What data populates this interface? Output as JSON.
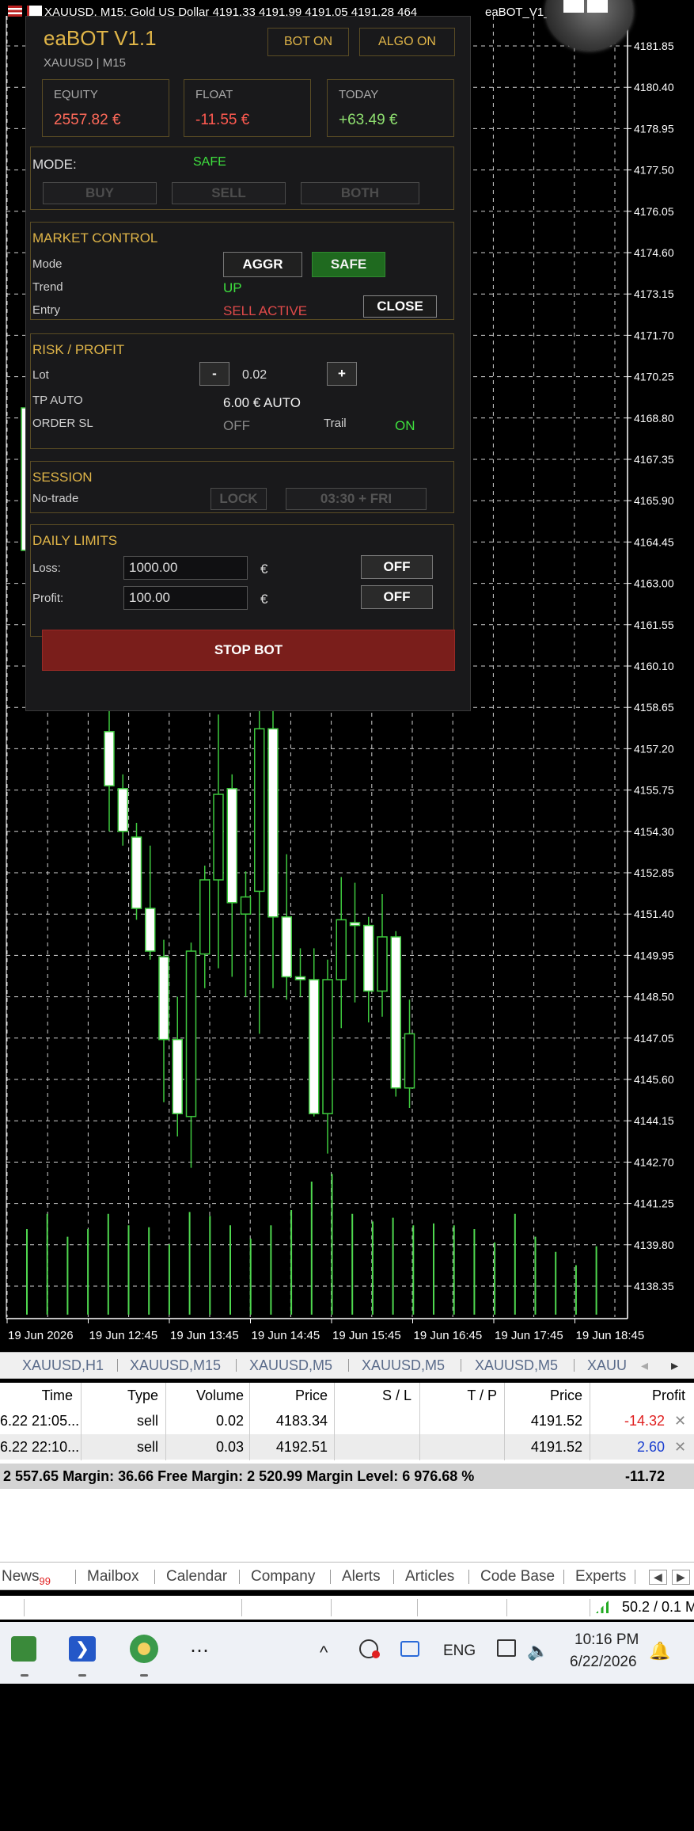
{
  "window": {
    "title": "XAUUSD, M15:  Gold US Dollar  4191.33 4191.99 4191.05 4191.28  464",
    "title_right": "eaBOT_V1_"
  },
  "panel": {
    "title": "eaBOT V1.1",
    "subtitle": "XAUUSD | M15",
    "bot_status": "BOT ON",
    "algo_status": "ALGO ON",
    "stats": [
      {
        "label": "EQUITY",
        "value": "2557.82 €",
        "color": "#ff6a5a"
      },
      {
        "label": "FLOAT",
        "value": "-11.55 €",
        "color": "#ff5a50"
      },
      {
        "label": "TODAY",
        "value": "+63.49 €",
        "color": "#8fe070"
      }
    ],
    "mode": {
      "label": "MODE:",
      "value": "SAFE",
      "buttons": [
        "BUY",
        "SELL",
        "BOTH"
      ]
    },
    "market": {
      "title": "MARKET CONTROL",
      "mode_label": "Mode",
      "aggr_label": "AGGR",
      "safe_label": "SAFE",
      "trend_label": "Trend",
      "trend_value": "UP",
      "entry_label": "Entry",
      "entry_value": "SELL ACTIVE",
      "close_label": "CLOSE"
    },
    "risk": {
      "title": "RISK / PROFIT",
      "lot_label": "Lot",
      "minus": "-",
      "lot_value": "0.02",
      "plus": "+",
      "tp_label": "TP AUTO",
      "tp_value": "6.00 € AUTO",
      "sl_label": "ORDER SL",
      "sl_value": "OFF",
      "trail_label": "Trail",
      "trail_value": "ON"
    },
    "session": {
      "title": "SESSION",
      "label": "No-trade",
      "lock_label": "LOCK",
      "time_label": "03:30 + FRI"
    },
    "daily": {
      "title": "DAILY LIMITS",
      "loss_label": "Loss:",
      "loss_value": "1000.00",
      "profit_label": "Profit:",
      "profit_value": "100.00",
      "currency": "€",
      "loss_toggle": "OFF",
      "profit_toggle": "OFF"
    },
    "stop_label": "STOP BOT"
  },
  "chart_data": {
    "type": "candlestick",
    "price_ticks": [
      "4181.85",
      "4180.40",
      "4178.95",
      "4177.50",
      "4176.05",
      "4174.60",
      "4173.15",
      "4171.70",
      "4170.25",
      "4168.80",
      "4167.35",
      "4165.90",
      "4164.45",
      "4163.00",
      "4161.55",
      "4160.10",
      "4158.65",
      "4157.20",
      "4155.75",
      "4154.30",
      "4152.85",
      "4151.40",
      "4149.95",
      "4148.50",
      "4147.05",
      "4145.60",
      "4144.15",
      "4142.70",
      "4141.25",
      "4139.80",
      "4138.35"
    ],
    "time_ticks": [
      "19 Jun 2026",
      "19 Jun 12:45",
      "19 Jun 13:45",
      "19 Jun 14:45",
      "19 Jun 15:45",
      "19 Jun 16:45",
      "19 Jun 17:45",
      "19 Jun 18:45"
    ],
    "candles": [
      {
        "o": 4157.8,
        "h": 4158.6,
        "l": 4154.3,
        "c": 4155.9
      },
      {
        "o": 4155.8,
        "h": 4156.3,
        "l": 4153.8,
        "c": 4154.3
      },
      {
        "o": 4154.1,
        "h": 4154.6,
        "l": 4151.2,
        "c": 4151.6
      },
      {
        "o": 4151.6,
        "h": 4153.8,
        "l": 4149.8,
        "c": 4150.1
      },
      {
        "o": 4149.9,
        "h": 4150.5,
        "l": 4144.8,
        "c": 4147.0
      },
      {
        "o": 4147.0,
        "h": 4148.5,
        "l": 4143.6,
        "c": 4144.4
      },
      {
        "o": 4144.3,
        "h": 4150.4,
        "l": 4142.5,
        "c": 4150.1
      },
      {
        "o": 4150.0,
        "h": 4153.1,
        "l": 4148.8,
        "c": 4152.6
      },
      {
        "o": 4152.6,
        "h": 4158.4,
        "l": 4149.5,
        "c": 4155.6
      },
      {
        "o": 4155.8,
        "h": 4156.3,
        "l": 4149.2,
        "c": 4151.8
      },
      {
        "o": 4151.4,
        "h": 4152.9,
        "l": 4148.5,
        "c": 4152.0
      },
      {
        "o": 4152.2,
        "h": 4158.9,
        "l": 4147.2,
        "c": 4157.9
      },
      {
        "o": 4157.9,
        "h": 4158.6,
        "l": 4148.8,
        "c": 4151.3
      },
      {
        "o": 4151.3,
        "h": 4153.5,
        "l": 4148.4,
        "c": 4149.2
      },
      {
        "o": 4149.2,
        "h": 4150.2,
        "l": 4148.5,
        "c": 4149.1
      },
      {
        "o": 4149.1,
        "h": 4150.2,
        "l": 4144.3,
        "c": 4144.4
      },
      {
        "o": 4144.4,
        "h": 4149.8,
        "l": 4143.0,
        "c": 4149.1
      },
      {
        "o": 4149.1,
        "h": 4152.7,
        "l": 4147.4,
        "c": 4151.2
      },
      {
        "o": 4151.1,
        "h": 4152.5,
        "l": 4148.3,
        "c": 4151.0
      },
      {
        "o": 4151.0,
        "h": 4151.3,
        "l": 4147.6,
        "c": 4148.7
      },
      {
        "o": 4148.7,
        "h": 4152.1,
        "l": 4147.8,
        "c": 4150.6
      },
      {
        "o": 4150.6,
        "h": 4150.8,
        "l": 4145.0,
        "c": 4145.3
      },
      {
        "o": 4145.3,
        "h": 4148.4,
        "l": 4144.6,
        "c": 4147.2
      }
    ],
    "volumes": [
      0.45,
      0.53,
      0.41,
      0.45,
      0.53,
      0.47,
      0.46,
      0.37,
      0.54,
      0.52,
      0.47,
      0.4,
      0.47,
      0.55,
      0.7,
      0.74,
      0.53,
      0.49,
      0.51,
      0.47,
      0.48,
      0.47,
      0.45,
      0.38,
      0.53,
      0.41,
      0.33,
      0.26,
      0.36
    ]
  },
  "symbol_tabs": [
    "XAUUSD,H1",
    "XAUUSD,M15",
    "XAUUSD,M5",
    "XAUUSD,M5",
    "XAUUSD,M5",
    "XAUU"
  ],
  "trade_table": {
    "headers": [
      "Time",
      "Type",
      "Volume",
      "Price",
      "S / L",
      "T / P",
      "Price",
      "Profit"
    ],
    "rows": [
      {
        "time": "6.22 21:05...",
        "type": "sell",
        "volume": "0.02",
        "price": "4183.34",
        "sl": "",
        "tp": "",
        "cur": "4191.52",
        "profit": "-14.32",
        "profit_color": "#e02020"
      },
      {
        "time": "6.22 22:10...",
        "type": "sell",
        "volume": "0.03",
        "price": "4192.51",
        "sl": "",
        "tp": "",
        "cur": "4191.52",
        "profit": "2.60",
        "profit_color": "#1a3fd0"
      }
    ],
    "balance_line": "2 557.65  Margin: 36.66  Free Margin: 2 520.99  Margin Level: 6 976.68 %",
    "total_profit": "-11.72"
  },
  "toolbox_tabs": {
    "news": "News",
    "news_badge": "99",
    "items": [
      "Mailbox",
      "Calendar",
      "Company",
      "Alerts",
      "Articles",
      "Code Base",
      "Experts"
    ]
  },
  "status": {
    "connection": "50.2 / 0.1 M"
  },
  "taskbar": {
    "lang": "ENG",
    "time": "10:16 PM",
    "date": "6/22/2026",
    "more": "⋯",
    "chevron": "^"
  }
}
